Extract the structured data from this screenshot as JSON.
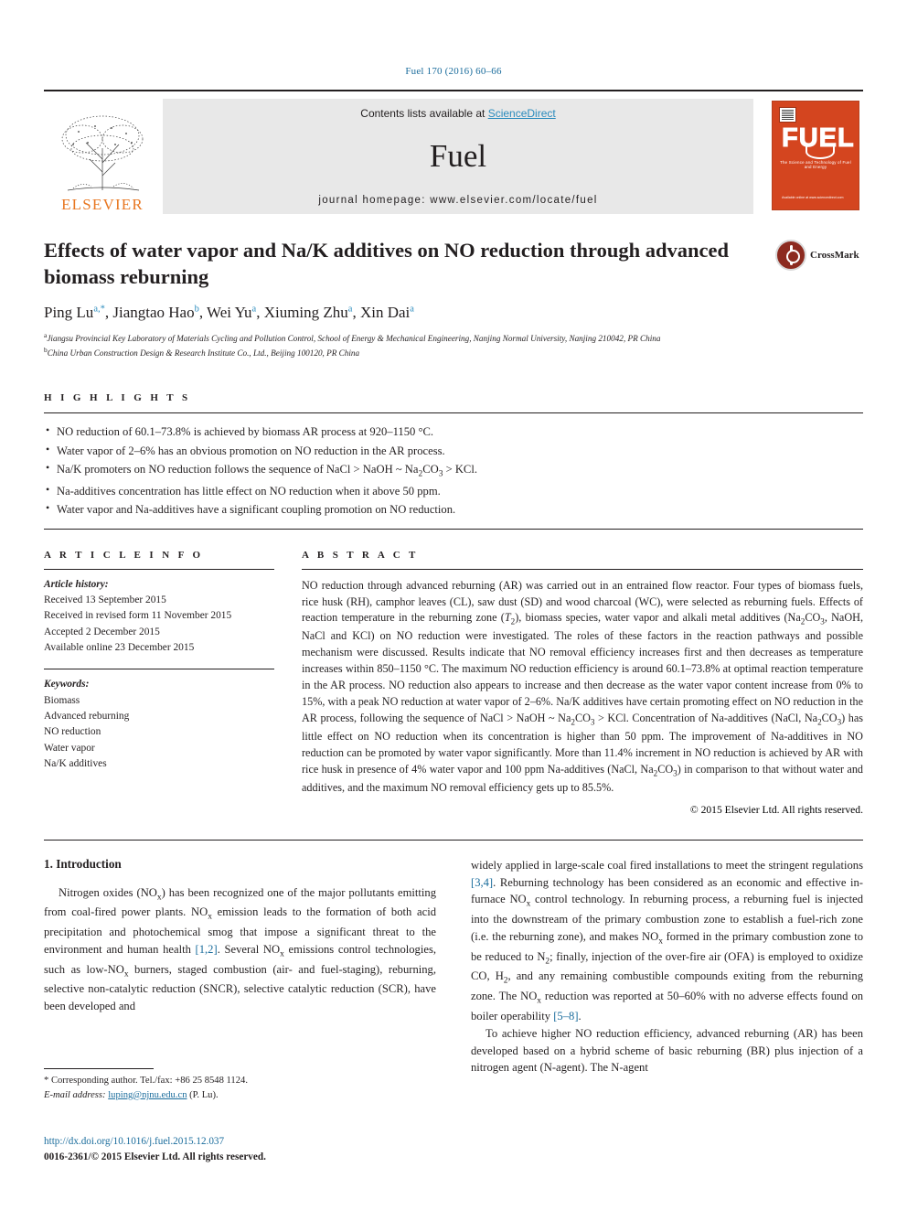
{
  "running_head": "Fuel 170 (2016) 60–66",
  "masthead": {
    "publisher_name": "ELSEVIER",
    "contents_prefix": "Contents lists available at ",
    "contents_link": "ScienceDirect",
    "journal_name": "Fuel",
    "homepage_line": "journal homepage: www.elsevier.com/locate/fuel",
    "cover": {
      "wordmark": "FUEL",
      "subtitle": "The Science and Technology of Fuel and Energy",
      "footer": "Available online at\nwww.sciencedirect.com"
    }
  },
  "article": {
    "title": "Effects of water vapor and Na/K additives on NO reduction through advanced biomass reburning",
    "crossmark_label": "CrossMark",
    "authors": [
      {
        "name": "Ping Lu",
        "marks": "a,*"
      },
      {
        "name": "Jiangtao Hao",
        "marks": "b"
      },
      {
        "name": "Wei Yu",
        "marks": "a"
      },
      {
        "name": "Xiuming Zhu",
        "marks": "a"
      },
      {
        "name": "Xin Dai",
        "marks": "a"
      }
    ],
    "affiliations": [
      {
        "mark": "a",
        "text": "Jiangsu Provincial Key Laboratory of Materials Cycling and Pollution Control, School of Energy & Mechanical Engineering, Nanjing Normal University, Nanjing 210042, PR China"
      },
      {
        "mark": "b",
        "text": "China Urban Construction Design & Research Institute Co., Ltd., Beijing 100120, PR China"
      }
    ]
  },
  "highlights": {
    "heading": "H I G H L I G H T S",
    "items": [
      "NO reduction of 60.1–73.8% is achieved by biomass AR process at 920–1150 °C.",
      "Water vapor of 2–6% has an obvious promotion on NO reduction in the AR process.",
      "Na/K promoters on NO reduction follows the sequence of NaCl > NaOH ~ Na2CO3 > KCl.",
      "Na-additives concentration has little effect on NO reduction when it above 50 ppm.",
      "Water vapor and Na-additives have a significant coupling promotion on NO reduction."
    ]
  },
  "article_info": {
    "heading": "A R T I C L E   I N F O",
    "history_label": "Article history:",
    "history": [
      "Received 13 September 2015",
      "Received in revised form 11 November 2015",
      "Accepted 2 December 2015",
      "Available online 23 December 2015"
    ],
    "keywords_label": "Keywords:",
    "keywords": [
      "Biomass",
      "Advanced reburning",
      "NO reduction",
      "Water vapor",
      "Na/K additives"
    ]
  },
  "abstract": {
    "heading": "A B S T R A C T",
    "text": "NO reduction through advanced reburning (AR) was carried out in an entrained flow reactor. Four types of biomass fuels, rice husk (RH), camphor leaves (CL), saw dust (SD) and wood charcoal (WC), were selected as reburning fuels. Effects of reaction temperature in the reburning zone (T2), biomass species, water vapor and alkali metal additives (Na2CO3, NaOH, NaCl and KCl) on NO reduction were investigated. The roles of these factors in the reaction pathways and possible mechanism were discussed. Results indicate that NO removal efficiency increases first and then decreases as temperature increases within 850–1150 °C. The maximum NO reduction efficiency is around 60.1–73.8% at optimal reaction temperature in the AR process. NO reduction also appears to increase and then decrease as the water vapor content increase from 0% to 15%, with a peak NO reduction at water vapor of 2–6%. Na/K additives have certain promoting effect on NO reduction in the AR process, following the sequence of NaCl > NaOH ~ Na2CO3 > KCl. Concentration of Na-additives (NaCl, Na2CO3) has little effect on NO reduction when its concentration is higher than 50 ppm. The improvement of Na-additives in NO reduction can be promoted by water vapor significantly. More than 11.4% increment in NO reduction is achieved by AR with rice husk in presence of 4% water vapor and 100 ppm Na-additives (NaCl, Na2CO3) in comparison to that without water and additives, and the maximum NO removal efficiency gets up to 85.5%.",
    "copyright": "© 2015 Elsevier Ltd. All rights reserved."
  },
  "introduction": {
    "section_title": "1. Introduction",
    "para1_part1": "Nitrogen oxides (NO",
    "para1": "Nitrogen oxides (NOx) has been recognized one of the major pollutants emitting from coal-fired power plants. NOx emission leads to the formation of both acid precipitation and photochemical smog that impose a significant threat to the environment and human health [1,2]. Several NOx emissions control technologies, such as low-NOx burners, staged combustion (air- and fuel-staging), reburning, selective non-catalytic reduction (SNCR), selective catalytic reduction (SCR), have been developed and",
    "para2": "widely applied in large-scale coal fired installations to meet the stringent regulations [3,4]. Reburning technology has been considered as an economic and effective in-furnace NOx control technology. In reburning process, a reburning fuel is injected into the downstream of the primary combustion zone to establish a fuel-rich zone (i.e. the reburning zone), and makes NOx formed in the primary combustion zone to be reduced to N2; finally, injection of the over-fire air (OFA) is employed to oxidize CO, H2, and any remaining combustible compounds exiting from the reburning zone. The NOx reduction was reported at 50–60% with no adverse effects found on boiler operability [5–8].",
    "para3": "To achieve higher NO reduction efficiency, advanced reburning (AR) has been developed based on a hybrid scheme of basic reburning (BR) plus injection of a nitrogen agent (N-agent). The N-agent",
    "refs": {
      "r1": "[1,2]",
      "r2": "[3,4]",
      "r3": "[5–8]"
    }
  },
  "footnotes": {
    "corresponding": "* Corresponding author. Tel./fax: +86 25 8548 1124.",
    "email_label": "E-mail address:",
    "email": "luping@njnu.edu.cn",
    "email_suffix": "(P. Lu)."
  },
  "footer": {
    "doi": "http://dx.doi.org/10.1016/j.fuel.2015.12.037",
    "issn": "0016-2361/© 2015 Elsevier Ltd. All rights reserved."
  },
  "colors": {
    "link_blue": "#1a6c9c",
    "elsevier_orange": "#e87722",
    "cover_orange": "#d4451f",
    "crossmark_red": "#8c2a1f"
  }
}
